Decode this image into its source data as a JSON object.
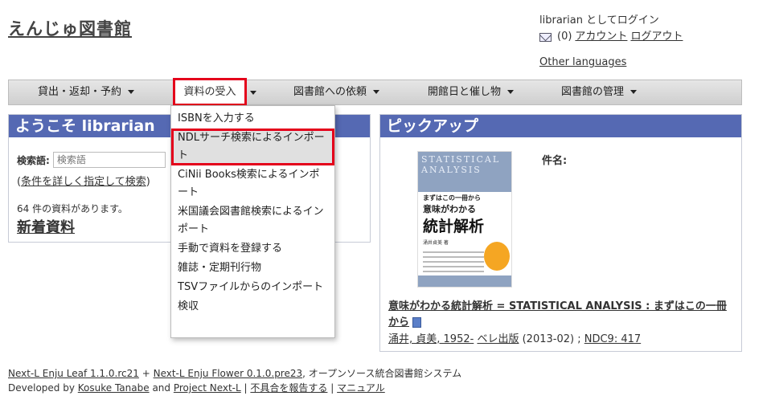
{
  "site": {
    "title": "えんじゅ図書館"
  },
  "user": {
    "login_text": "librarian としてログイン",
    "message_count": "(0)",
    "account_link": "アカウント",
    "logout_link": "ログアウト",
    "other_languages": "Other languages"
  },
  "nav": {
    "items": [
      {
        "label": "貸出・返却・予約"
      },
      {
        "label": "資料の受入"
      },
      {
        "label": "図書館への依頼"
      },
      {
        "label": "開館日と催し物"
      },
      {
        "label": "図書館の管理"
      }
    ]
  },
  "dropdown": {
    "items": [
      {
        "label": "ISBNを入力する"
      },
      {
        "label": "NDLサーチ検索によるインポート"
      },
      {
        "label": "CiNii Books検索によるインポート"
      },
      {
        "label": "米国議会図書館検索によるインポート"
      },
      {
        "label": "手動で資料を登録する"
      },
      {
        "label": "雑誌・定期刊行物"
      },
      {
        "label": "TSVファイルからのインポート"
      },
      {
        "label": "検収"
      }
    ],
    "highlighted_index": 1
  },
  "welcome": {
    "heading": "ようこそ librarian",
    "search_label": "検索語:",
    "search_placeholder": "検索語",
    "detail_link": "条件を詳しく指定して検索",
    "count_text": "64 件の資料があります。",
    "new_items": "新着資料"
  },
  "pickup": {
    "heading": "ピックアップ",
    "subject_label": "件名:",
    "cover": {
      "top_text": "STATISTICAL ANALYSIS",
      "sub_text": "まずはこの一冊から",
      "title_line1": "意味がわかる",
      "title_line2": "統計解析",
      "author": "涌井貞美 著"
    },
    "book_title": "意味がわかる統計解析 = STATISTICAL ANALYSIS : まずはこの一冊から",
    "author_link": "涌井, 貞美, 1952-",
    "publisher_link": "ベレ出版",
    "date": "(2013-02) ;",
    "ndc_link": "NDC9: 417"
  },
  "footer": {
    "leaf_link": "Next-L Enju Leaf 1.1.0.rc21",
    "plus": "+",
    "flower_link": "Next-L Enju Flower 0.1.0.pre23",
    "system_text": ", オープンソース統合図書館システム",
    "developed_by": "Developed by",
    "author_link": "Kosuke Tanabe",
    "and_text": "and",
    "project_link": "Project Next-L",
    "sep": "|",
    "report_link": "不具合を報告する",
    "manual_link": "マニュアル"
  },
  "colors": {
    "panel_header": "#5569b3",
    "highlight_border": "#e4001b",
    "nav_bg": "#d9d9d9"
  }
}
